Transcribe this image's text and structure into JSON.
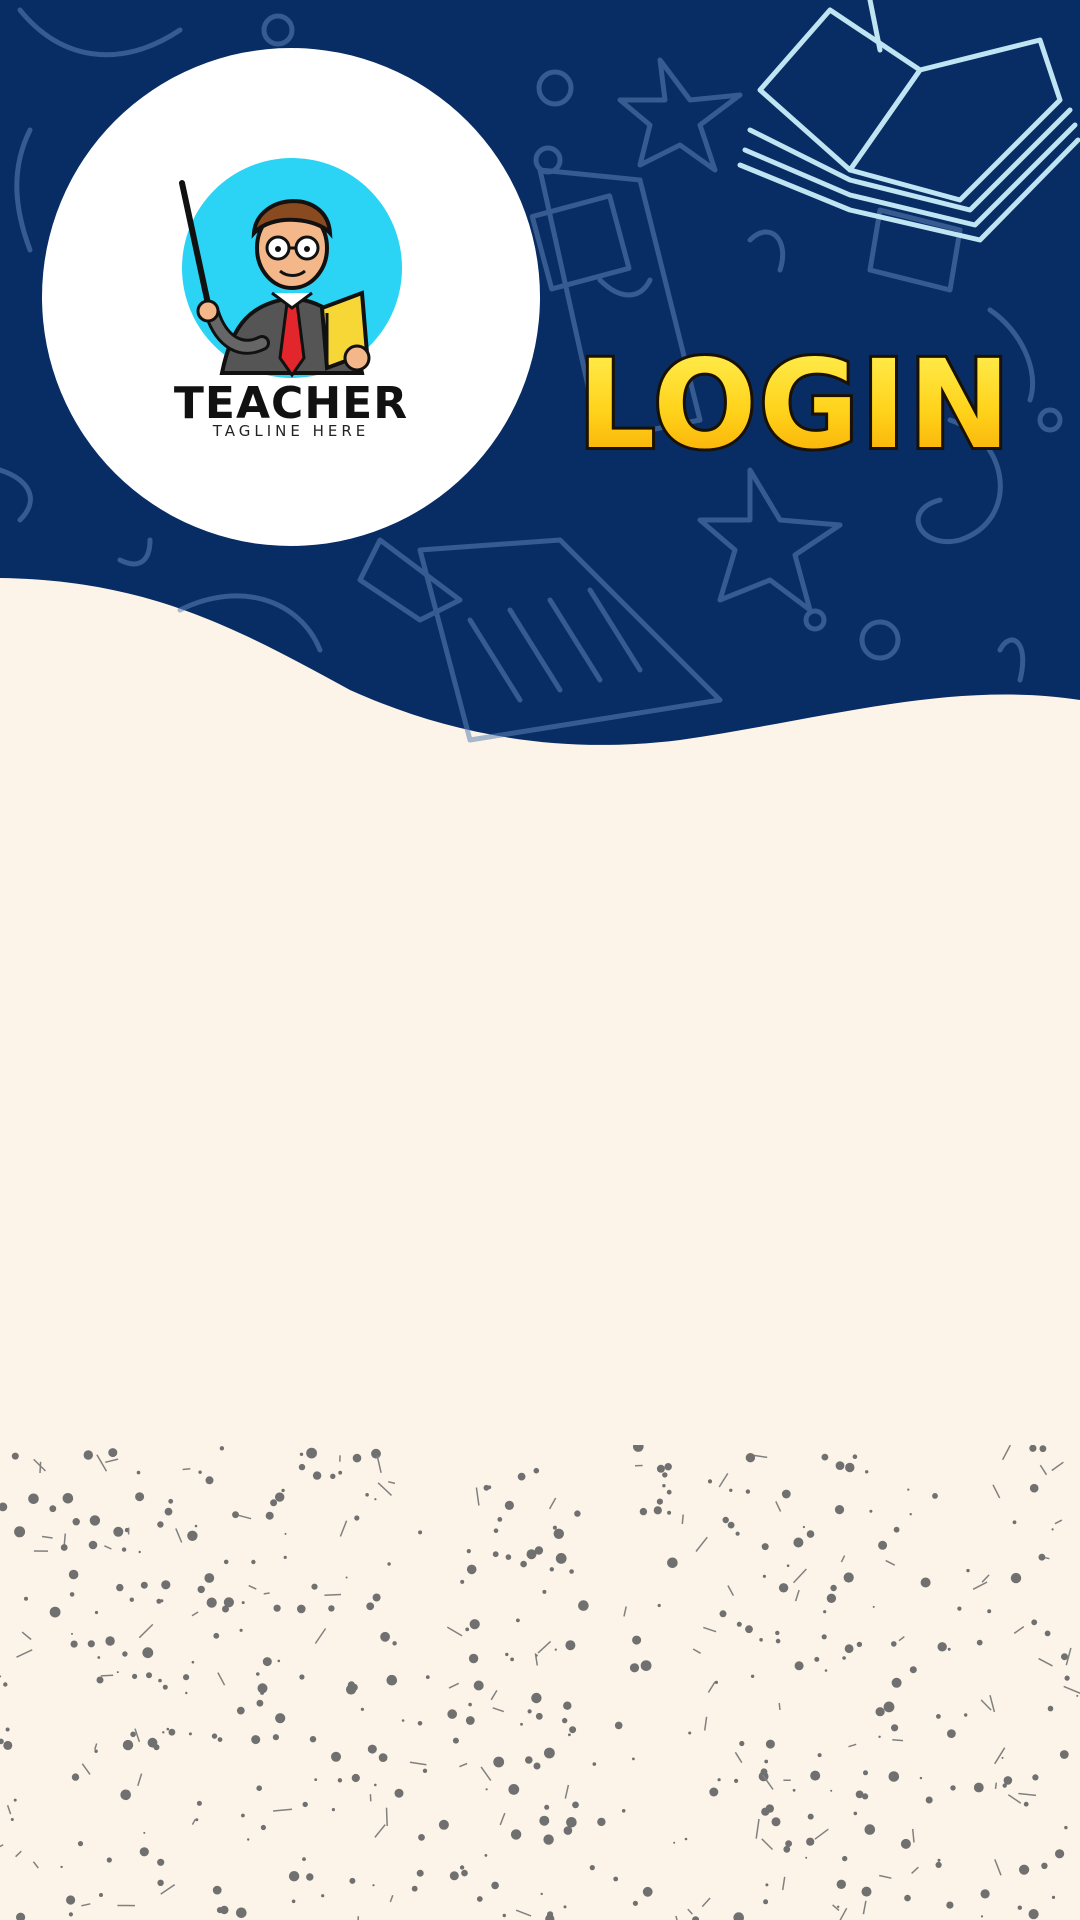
{
  "logo": {
    "title": "TEACHER",
    "tagline": "TAGLINE HERE"
  },
  "login_title": "LOGIN",
  "colors": {
    "navy": "#082c64",
    "cream": "#fcf4e9",
    "doodle": "#8fb3d6",
    "accent_yellow": "#ffd21a",
    "mascot_bg": "#2bd3f5"
  }
}
